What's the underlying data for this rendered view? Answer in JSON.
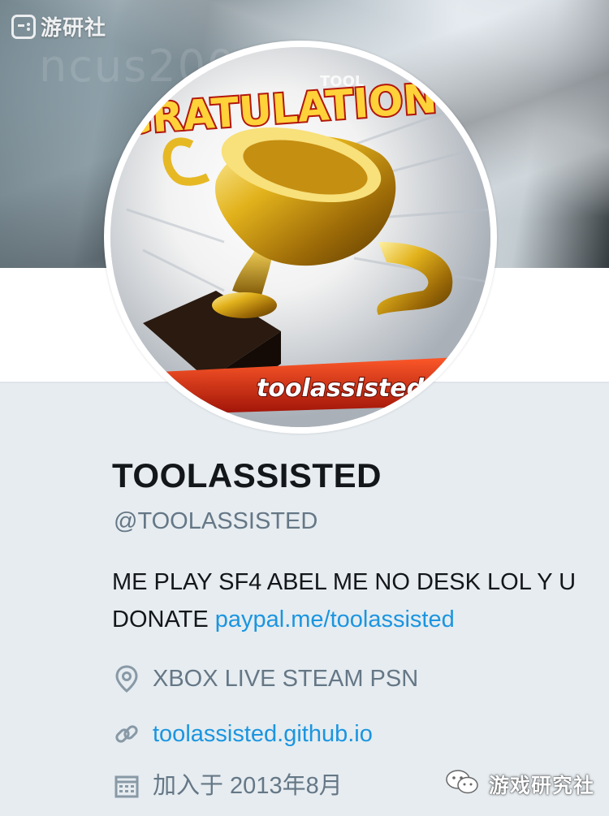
{
  "banner": {
    "faint_text": "ncus200"
  },
  "watermark": {
    "top_text": "游研社",
    "bottom_text": "游戏研究社"
  },
  "avatar": {
    "banner_text": "GRATULATION",
    "ribbon_text": "toolassisted",
    "top_small_text": "TOOL"
  },
  "profile": {
    "display_name": "TOOLASSISTED",
    "handle": "@TOOLASSISTED",
    "bio_text": "ME PLAY SF4 ABEL ME NO DESK LOL Y U DONATE ",
    "bio_link": "paypal.me/toolassisted",
    "location": "XBOX LIVE STEAM PSN",
    "website": "toolassisted.github.io",
    "joined": "加入于 2013年8月"
  },
  "colors": {
    "link": "#1b95e0",
    "text": "#14171a",
    "muted": "#657786",
    "background": "#e6ecf0"
  }
}
